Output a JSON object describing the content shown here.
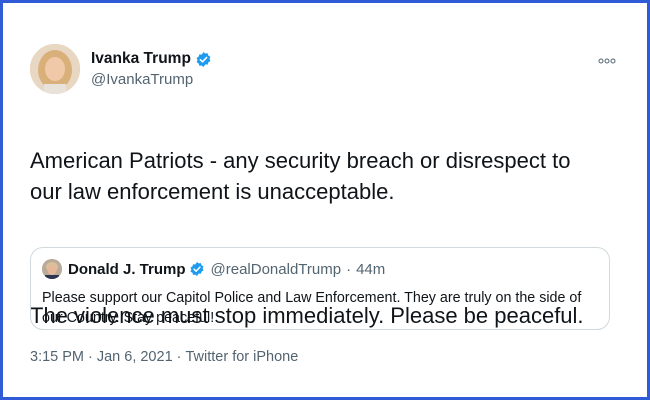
{
  "tweet": {
    "author": {
      "name": "Ivanka Trump",
      "handle": "@IvankaTrump"
    },
    "paragraphs": [
      "American Patriots - any security breach or disrespect to\nour law enforcement is unacceptable.",
      "The violence must stop immediately. Please be peaceful."
    ],
    "quoted": {
      "name": "Donald J. Trump",
      "handle": "@realDonaldTrump",
      "separator": "·",
      "time_ago": "44m",
      "text": "Please support our Capitol Police and Law Enforcement. They are truly on the side of our Country. Stay peaceful!"
    },
    "footer": {
      "time": "3:15 PM",
      "separator": "·",
      "date": "Jan 6, 2021",
      "source": "Twitter for iPhone"
    }
  },
  "icons": {
    "verified": "verified-badge-icon",
    "more": "more-options-icon"
  },
  "colors": {
    "frame_border": "#2f5bd6",
    "verified_blue": "#1d9bf0",
    "secondary_text": "#536471",
    "primary_text": "#0f1419",
    "quote_border": "#cfd9de"
  }
}
